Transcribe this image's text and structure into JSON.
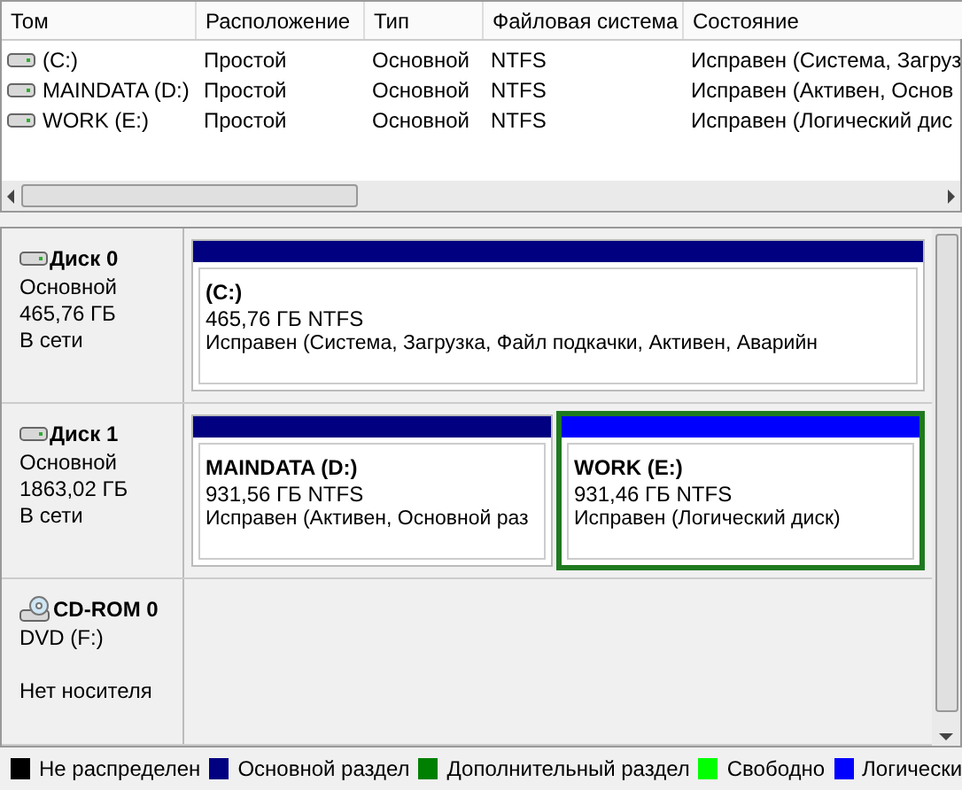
{
  "volume_list": {
    "columns": [
      "Том",
      "Расположение",
      "Тип",
      "Файловая система",
      "Состояние"
    ],
    "rows": [
      {
        "cells": [
          "(C:)",
          "Простой",
          "Основной",
          "NTFS",
          "Исправен (Система, Загруз"
        ]
      },
      {
        "cells": [
          "MAINDATA (D:)",
          "Простой",
          "Основной",
          "NTFS",
          "Исправен (Активен, Основ"
        ]
      },
      {
        "cells": [
          "WORK (E:)",
          "Простой",
          "Основной",
          "NTFS",
          "Исправен (Логический дис"
        ]
      }
    ]
  },
  "disks": [
    {
      "kind": "disk",
      "name": "Диск 0",
      "lines": [
        "Основной",
        "465,76 ГБ",
        "В сети"
      ],
      "partitions": [
        {
          "label": "(C:)",
          "size": "465,76 ГБ NTFS",
          "status": "Исправен (Система, Загрузка, Файл подкачки, Активен, Аварийн",
          "color": "#000080",
          "selected": false
        }
      ]
    },
    {
      "kind": "disk",
      "name": "Диск 1",
      "lines": [
        "Основной",
        "1863,02 ГБ",
        "В сети"
      ],
      "partitions": [
        {
          "label": "MAINDATA  (D:)",
          "size": "931,56 ГБ NTFS",
          "status": "Исправен (Активен, Основной раз",
          "color": "#000080",
          "selected": false
        },
        {
          "label": "WORK  (E:)",
          "size": "931,46 ГБ NTFS",
          "status": "Исправен (Логический диск)",
          "color": "#0000ff",
          "selected": true
        }
      ]
    },
    {
      "kind": "cdrom",
      "name": "CD-ROM 0",
      "lines": [
        "DVD (F:)"
      ],
      "media_status": "Нет носителя"
    }
  ],
  "legend": [
    {
      "label": "Не распределен",
      "color": "#000000"
    },
    {
      "label": "Основной раздел",
      "color": "#000080"
    },
    {
      "label": "Дополнительный раздел",
      "color": "#008000"
    },
    {
      "label": "Свободно",
      "color": "#00ff00"
    },
    {
      "label": "Логически",
      "color": "#0000ff"
    }
  ]
}
